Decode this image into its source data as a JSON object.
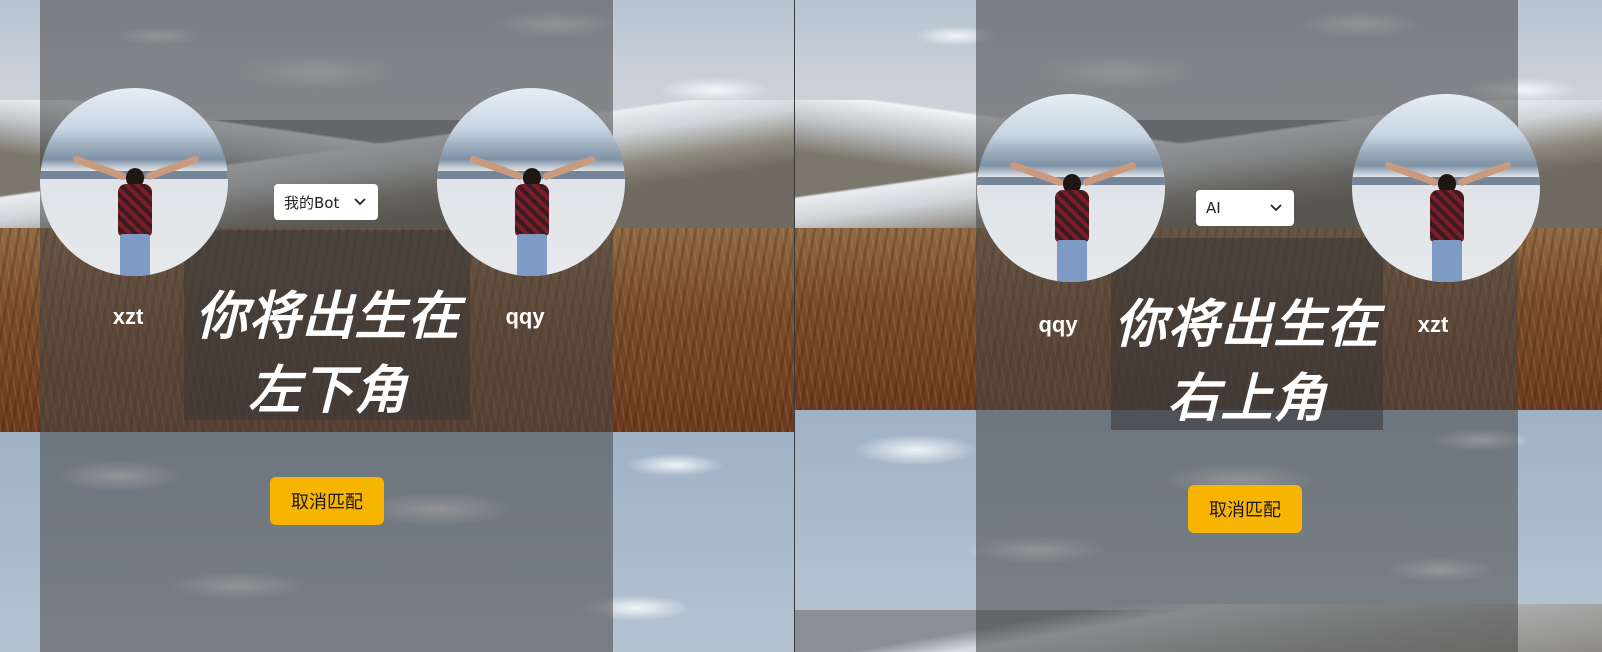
{
  "left_panel": {
    "player_left_name": "xzt",
    "player_right_name": "qqy",
    "select_value": "我的Bot",
    "birth_line1": "你将出生在",
    "birth_line2": "左下角",
    "cancel_label": "取消匹配"
  },
  "right_panel": {
    "player_left_name": "qqy",
    "player_right_name": "xzt",
    "select_value": "AI",
    "birth_line1": "你将出生在",
    "birth_line2": "右上角",
    "cancel_label": "取消匹配"
  },
  "colors": {
    "button_accent": "#f7b400",
    "overlay": "#464646"
  },
  "icons": {
    "select_chevron": "chevron-down-icon"
  }
}
